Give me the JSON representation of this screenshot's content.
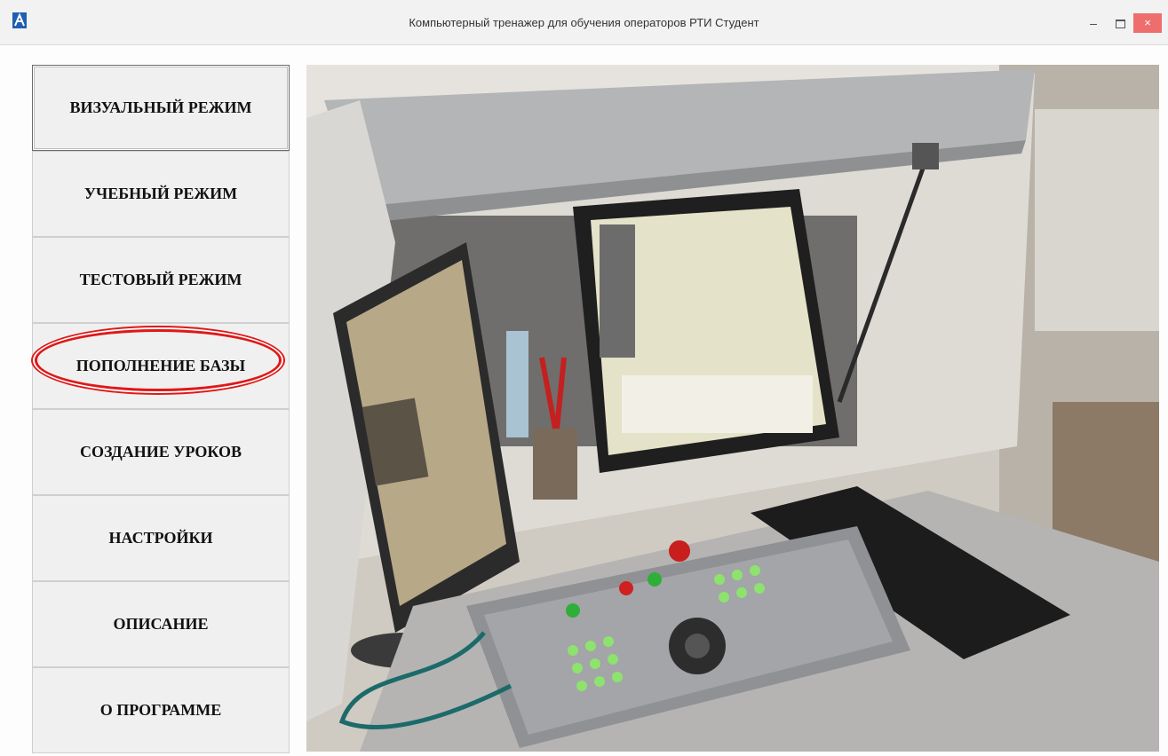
{
  "window": {
    "title": "Компьютерный тренажер для обучения операторов РТИ Студент",
    "controls": {
      "minimize": "–",
      "maximize": "",
      "close": "×"
    }
  },
  "menu": {
    "items": [
      {
        "label": "ВИЗУАЛЬНЫЙ РЕЖИМ",
        "active": true
      },
      {
        "label": "УЧЕБНЫЙ РЕЖИМ"
      },
      {
        "label": "ТЕСТОВЫЙ РЕЖИМ"
      },
      {
        "label": "ПОПОЛНЕНИЕ БАЗЫ",
        "highlighted": true
      },
      {
        "label": "СОЗДАНИЕ УРОКОВ"
      },
      {
        "label": "НАСТРОЙКИ"
      },
      {
        "label": "ОПИСАНИЕ"
      },
      {
        "label": "О ПРОГРАММЕ"
      }
    ]
  },
  "colors": {
    "highlight_ring": "#e01818",
    "close_button": "#ee6d6d"
  }
}
